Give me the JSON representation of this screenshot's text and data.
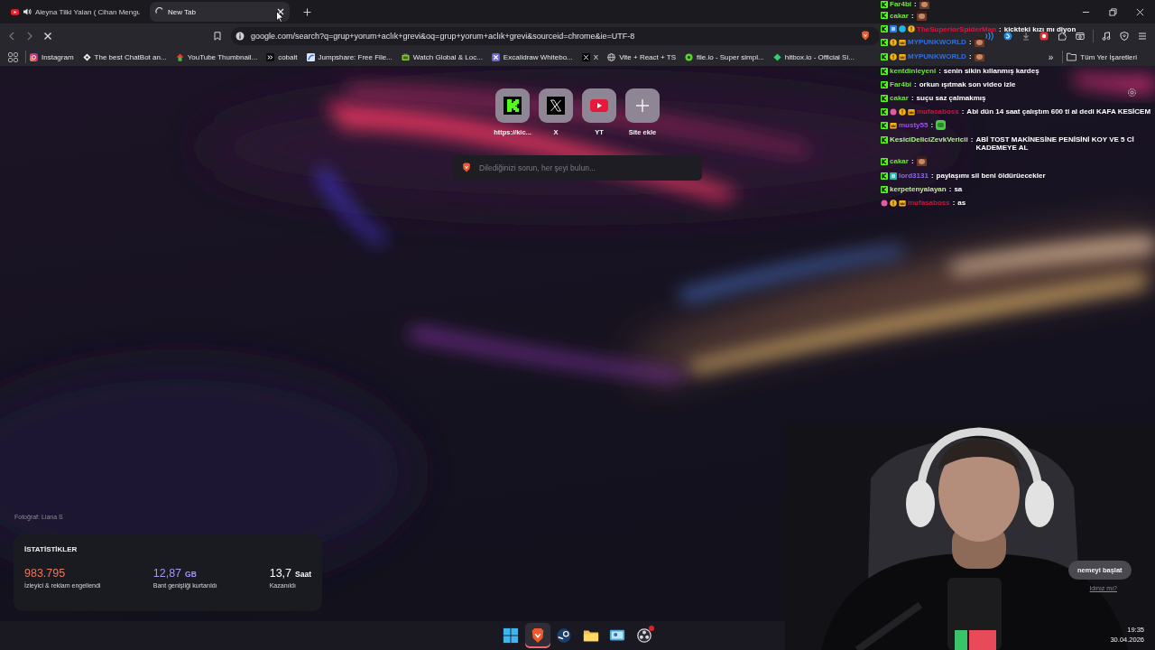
{
  "browser": {
    "tabs": [
      {
        "title": "Aleyna Tilki Yalan ( Cihan Mengu",
        "selected": false,
        "audio": true,
        "loading": false
      },
      {
        "title": "New Tab",
        "selected": true,
        "audio": false,
        "loading": true
      }
    ],
    "address": {
      "url": "google.com/search?q=grup+yorum+aclık+grevi&oq=grup+yorum+aclık+grevi&sourceid=chrome&ie=UTF-8"
    },
    "bookmarks": [
      {
        "label": "Instagram"
      },
      {
        "label": "The best ChatBot an..."
      },
      {
        "label": "YouTube Thumbnail..."
      },
      {
        "label": "cobalt"
      },
      {
        "label": "Jumpshare: Free File..."
      },
      {
        "label": "Watch Global & Loc..."
      },
      {
        "label": "Excalidraw Whitebo..."
      },
      {
        "label": "X"
      },
      {
        "label": "Vite + React + TS"
      },
      {
        "label": "file.io - Super simpl..."
      },
      {
        "label": "hitbox.io - Official Si..."
      }
    ],
    "bookmarks_overflow": "»",
    "all_bookmarks": "Tüm Yer İşaretleri"
  },
  "new_tab": {
    "shortcuts": [
      {
        "label": "https://kic...",
        "kind": "site"
      },
      {
        "label": "X",
        "kind": "site"
      },
      {
        "label": "YT",
        "kind": "site"
      },
      {
        "label": "Site ekle",
        "kind": "add"
      }
    ],
    "search": {
      "placeholder": "Dilediğinizi sorun, her şeyi bulun..."
    },
    "photo_credit": "Fotoğraf: Liana S",
    "stats": {
      "title": "İSTATİSTİKLER",
      "items": [
        {
          "value": "983.795",
          "label": "İzleyici & reklam engellendi",
          "color": "#e8785e"
        },
        {
          "value": "12,87",
          "unit": "GB",
          "label": "Bant genişliği kurtarıldı",
          "color": "#a497f2"
        },
        {
          "value": "13,7",
          "unit": "Saat",
          "label": "Kazanıldı",
          "color": "#ffffff"
        }
      ]
    },
    "promo": {
      "button": "nemeyi başlat",
      "link": "ldınız mı?"
    }
  },
  "chat": [
    {
      "badges": [
        {
          "kind": "k"
        }
      ],
      "user": "Far4bi",
      "color": "#74e23f",
      "sep": ":",
      "emote": {
        "kind": "face"
      }
    },
    {
      "badges": [
        {
          "kind": "k"
        }
      ],
      "user": "cakar",
      "color": "#74e23f",
      "sep": ":",
      "emote": {
        "kind": "face"
      }
    },
    {
      "badges": [
        {
          "kind": "k"
        },
        {
          "kind": "blue"
        },
        {
          "kind": "cyan"
        },
        {
          "kind": "gold"
        }
      ],
      "user": "TheSuperiorSpiderMan",
      "color": "#d8173f",
      "sep": ":",
      "message": "kickteki kızı mı diyon"
    },
    {
      "badges": [
        {
          "kind": "k"
        },
        {
          "kind": "gold"
        },
        {
          "kind": "crown"
        }
      ],
      "user": "MYPUNKWORLD",
      "color": "#2f6fe4",
      "sep": ":",
      "emote": {
        "kind": "face"
      }
    },
    {
      "badges": [
        {
          "kind": "k"
        },
        {
          "kind": "gold"
        },
        {
          "kind": "crown"
        }
      ],
      "user": "MYPUNKWORLD",
      "color": "#2f6fe4",
      "sep": ":",
      "emote": {
        "kind": "face"
      }
    },
    {
      "badges": [
        {
          "kind": "k"
        }
      ],
      "user": "kentdinleyeni",
      "color": "#74e23f",
      "sep": ":",
      "message": "senin sikin kıllanmış kardeş"
    },
    {
      "badges": [
        {
          "kind": "k"
        }
      ],
      "user": "Far4bi",
      "color": "#74e23f",
      "sep": ":",
      "message": "orkun ışıtmak son video izle"
    },
    {
      "badges": [
        {
          "kind": "k"
        }
      ],
      "user": "cakar",
      "color": "#74e23f",
      "sep": ":",
      "message": "suçu saz çalmakmış"
    },
    {
      "badges": [
        {
          "kind": "k"
        },
        {
          "kind": "pink"
        },
        {
          "kind": "gold"
        },
        {
          "kind": "crown"
        }
      ],
      "user": "mufasaboss",
      "color": "#c8183e",
      "sep": ":",
      "message": "Abi dün 14 saat çalıştım 600 tl al dedi KAFA KESİCEM"
    },
    {
      "badges": [
        {
          "kind": "k"
        },
        {
          "kind": "crown"
        }
      ],
      "user": "musty55",
      "color": "#9a52e6",
      "sep": ":",
      "emote": {
        "kind": "green"
      }
    },
    {
      "badges": [
        {
          "kind": "k"
        }
      ],
      "user": "KesiciDeliciZevkVericii",
      "color": "#b9eca0",
      "sep": ":",
      "message": "ABİ TOST MAKİNESİNE PENİSİNİ KOY VE 5 Cİ KADEMEYE AL"
    },
    {
      "badges": [
        {
          "kind": "k"
        }
      ],
      "user": "cakar",
      "color": "#74e23f",
      "sep": ":",
      "emote": {
        "kind": "face"
      }
    },
    {
      "badges": [
        {
          "kind": "k"
        },
        {
          "kind": "teal"
        }
      ],
      "user": "lord3131",
      "color": "#8a6ce4",
      "sep": ":",
      "message": "paylaşımı sil beni öldürüecekler"
    },
    {
      "badges": [
        {
          "kind": "k"
        }
      ],
      "user": "kerpetenyalayan",
      "color": "#c6e6a2",
      "sep": ":",
      "message": "sa"
    },
    {
      "badges": [
        {
          "kind": "pink"
        },
        {
          "kind": "gold"
        },
        {
          "kind": "crown"
        }
      ],
      "user": "mufasaboss",
      "color": "#c8183e",
      "sep": ":",
      "message": "as"
    }
  ],
  "taskbar": {
    "apps": [
      {
        "selected": false,
        "notification": false
      },
      {
        "selected": true,
        "notification": false
      },
      {
        "selected": false,
        "notification": false
      },
      {
        "selected": false,
        "notification": false
      },
      {
        "selected": false,
        "notification": false
      },
      {
        "selected": false,
        "notification": true
      }
    ],
    "time": "19:35",
    "date": "30.04.2026"
  }
}
